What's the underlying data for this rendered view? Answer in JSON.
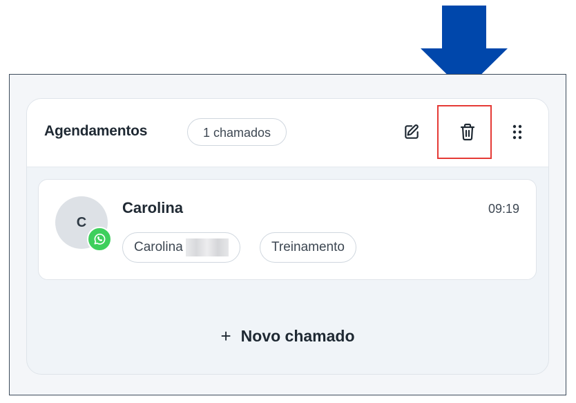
{
  "column": {
    "title": "Agendamentos",
    "count_label": "1 chamados",
    "edit_icon": "edit-icon",
    "delete_icon": "trash-icon",
    "drag_icon": "drag-handle-icon"
  },
  "card": {
    "avatar_initial": "C",
    "channel_icon": "whatsapp-icon",
    "name": "Carolina",
    "time": "09:19",
    "tags": {
      "contact": "Carolina",
      "queue": "Treinamento"
    }
  },
  "footer": {
    "plus": "+",
    "new_ticket_label": "Novo chamado"
  },
  "annotation": {
    "arrow_color": "#0047ab",
    "highlight_color": "#e53935"
  },
  "colors": {
    "whatsapp": "#3ecf5c",
    "column_bg": "#f0f4f8"
  }
}
